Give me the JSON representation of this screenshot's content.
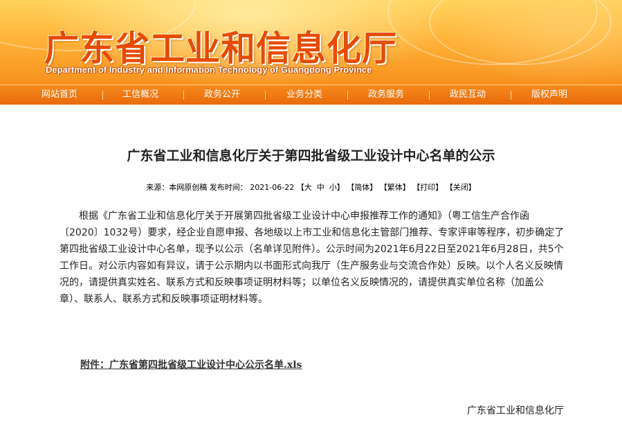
{
  "header": {
    "title": "广东省工业和信息化厅",
    "subtitle": "Department of Industry and Information Technology of Guangdong Province"
  },
  "nav": {
    "items": [
      "网站首页",
      "工信概况",
      "政务公开",
      "业务分类",
      "政务服务",
      "政民互动",
      "版权声明"
    ]
  },
  "article": {
    "title": "广东省工业和信息化厅关于第四批省级工业设计中心名单的公示",
    "meta": {
      "source": "来源：本网原创稿 发布时间：",
      "date": "2021-06-22",
      "font_large": "大",
      "font_medium": "中",
      "font_small": "小",
      "simplified": "简体",
      "traditional": "繁体",
      "print": "打印",
      "close": "关闭"
    },
    "body": "根据《广东省工业和信息化厅关于开展第四批省级工业设计中心申报推荐工作的通知》（粤工信生产合作函〔2020〕1032号）要求，经企业自愿申报、各地级以上市工业和信息化主管部门推荐、专家评审等程序，初步确定了第四批省级工业设计中心名单，现予以公示（名单详见附件）。公示时间为2021年6月22日至2021年6月28日，共5个工作日。对公示内容如有异议，请于公示期内以书面形式向我厅（生产服务业与交流合作处）反映。以个人名义反映情况的，请提供真实姓名、联系方式和反映事项证明材料等；以单位名义反映情况的，请提供真实单位名称（加盖公章）、联系人、联系方式和反映事项证明材料等。",
    "attachment": "附件：广东省第四批省级工业设计中心公示名单.xls",
    "signature": "广东省工业和信息化厅"
  }
}
